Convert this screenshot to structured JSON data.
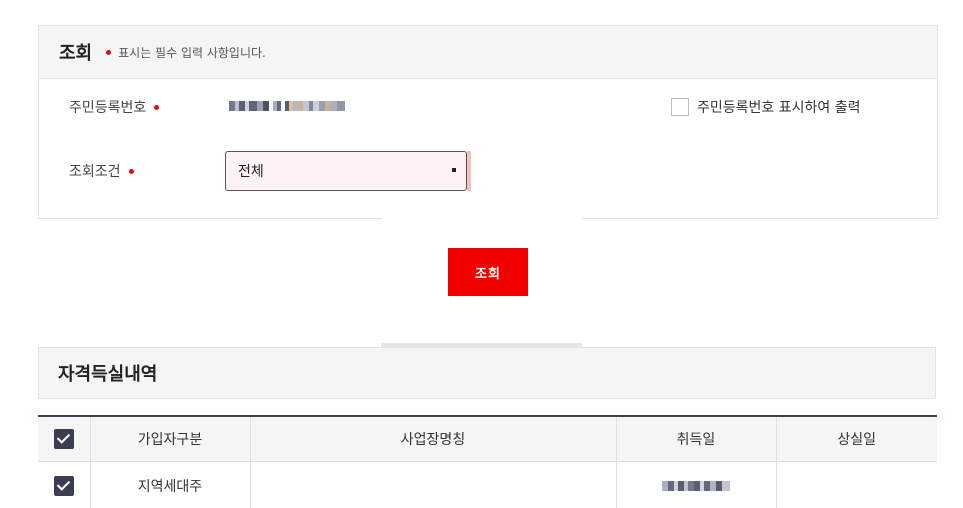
{
  "search": {
    "title": "조회",
    "required_note": "표시는 필수 입력 사항입니다.",
    "fields": {
      "resident_number_label": "주민등록번호",
      "condition_label": "조회조건",
      "condition_selected": "전체"
    },
    "show_number_checkbox": {
      "label": "주민등록번호 표시하여 출력",
      "checked": false
    },
    "button_label": "조회"
  },
  "result": {
    "title": "자격득실내역",
    "columns": [
      "가입자구분",
      "사업장명칭",
      "취득일",
      "상실일"
    ],
    "header_checked": true,
    "rows": [
      {
        "checked": true,
        "subscriber_type": "지역세대주",
        "workplace_name": "",
        "lost_date": ""
      }
    ]
  },
  "colors": {
    "accent_red": "#f20000",
    "required_dot": "#e30613",
    "table_border_dark": "#3f3f5a",
    "checkbox_dark": "#3d3d52",
    "select_bg": "#fff3f3"
  }
}
